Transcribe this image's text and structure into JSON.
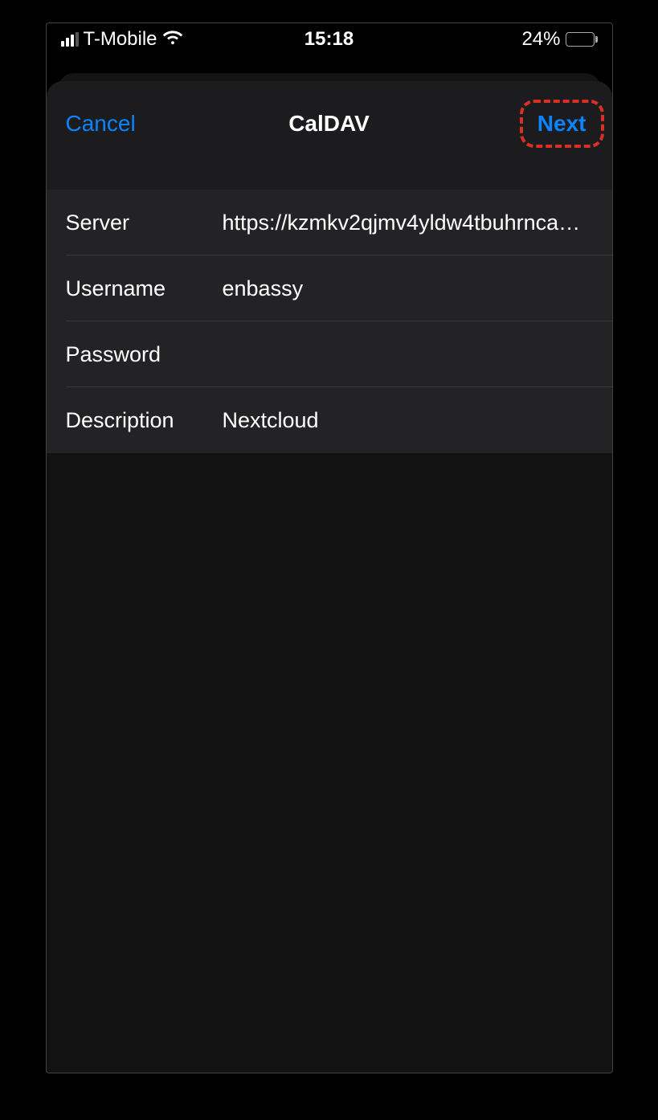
{
  "statusBar": {
    "carrier": "T-Mobile",
    "time": "15:18",
    "batteryPercent": "24%"
  },
  "navBar": {
    "cancel": "Cancel",
    "title": "CalDAV",
    "next": "Next"
  },
  "form": {
    "serverLabel": "Server",
    "serverValue": "https://kzmkv2qjmv4yldw4tbuhrnca…",
    "usernameLabel": "Username",
    "usernameValue": "enbassy",
    "passwordLabel": "Password",
    "passwordValue": "",
    "descriptionLabel": "Description",
    "descriptionValue": "Nextcloud"
  }
}
